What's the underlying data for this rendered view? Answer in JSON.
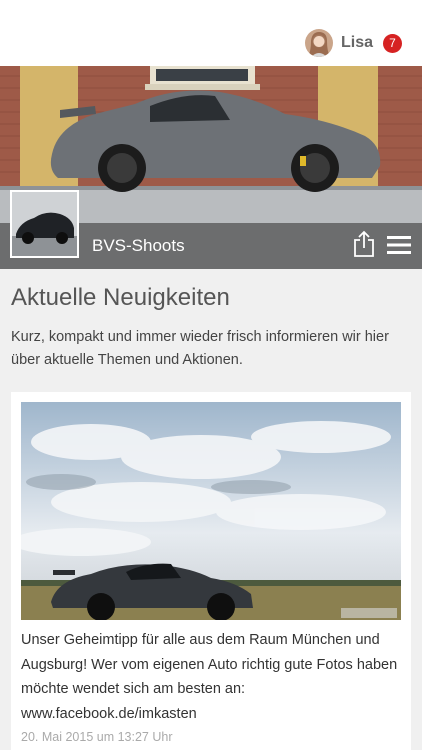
{
  "header": {
    "user_name": "Lisa",
    "notification_count": "7",
    "avatar_icon": "avatar-icon"
  },
  "hero": {
    "title": "BVS-Shoots",
    "share_icon": "share-icon",
    "menu_icon": "hamburger-menu-icon"
  },
  "section": {
    "title": "Aktuelle Neuigkeiten",
    "description": "Kurz, kompakt und immer wieder frisch informieren wir hier über aktuelle Themen und Aktionen."
  },
  "news": [
    {
      "text": "Unser Geheimtipp für alle aus dem Raum München und Augsburg! Wer vom eigenen Auto richtig gute Fotos haben möchte wendet sich am besten an: www.facebook.de/imkasten",
      "date": "20. Mai 2015 um 13:27 Uhr"
    }
  ],
  "colors": {
    "badge": "#d62222",
    "hero_bar": "#5c5c5c",
    "background": "#f0f0f0"
  }
}
